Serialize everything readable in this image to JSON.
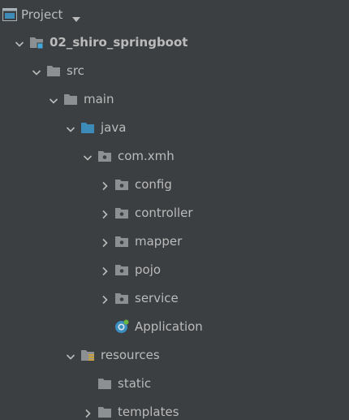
{
  "panel": {
    "title": "Project",
    "title_icon": "project-window-icon",
    "dropdown_icon": "dropdown-arrow-icon"
  },
  "tree": [
    {
      "label": "02_shiro_springboot",
      "icon": "module-folder-icon",
      "expanded": true,
      "has_chevron": true,
      "bold": true,
      "depth": 0
    },
    {
      "label": "src",
      "icon": "folder-icon",
      "expanded": true,
      "has_chevron": true,
      "bold": false,
      "depth": 1
    },
    {
      "label": "main",
      "icon": "folder-icon",
      "expanded": true,
      "has_chevron": true,
      "bold": false,
      "depth": 2
    },
    {
      "label": "java",
      "icon": "source-root-folder-icon",
      "expanded": true,
      "has_chevron": true,
      "bold": false,
      "depth": 3
    },
    {
      "label": "com.xmh",
      "icon": "package-icon",
      "expanded": true,
      "has_chevron": true,
      "bold": false,
      "depth": 4
    },
    {
      "label": "config",
      "icon": "package-icon",
      "expanded": false,
      "has_chevron": true,
      "bold": false,
      "depth": 5
    },
    {
      "label": "controller",
      "icon": "package-icon",
      "expanded": false,
      "has_chevron": true,
      "bold": false,
      "depth": 5
    },
    {
      "label": "mapper",
      "icon": "package-icon",
      "expanded": false,
      "has_chevron": true,
      "bold": false,
      "depth": 5
    },
    {
      "label": "pojo",
      "icon": "package-icon",
      "expanded": false,
      "has_chevron": true,
      "bold": false,
      "depth": 5
    },
    {
      "label": "service",
      "icon": "package-icon",
      "expanded": false,
      "has_chevron": true,
      "bold": false,
      "depth": 5
    },
    {
      "label": "Application",
      "icon": "spring-boot-class-icon",
      "expanded": false,
      "has_chevron": false,
      "bold": false,
      "depth": 5
    },
    {
      "label": "resources",
      "icon": "resources-root-folder-icon",
      "expanded": true,
      "has_chevron": true,
      "bold": false,
      "depth": 3
    },
    {
      "label": "static",
      "icon": "folder-icon",
      "expanded": false,
      "has_chevron": false,
      "bold": false,
      "depth": 4
    },
    {
      "label": "templates",
      "icon": "folder-icon",
      "expanded": false,
      "has_chevron": true,
      "bold": false,
      "depth": 4
    }
  ],
  "colors": {
    "background": "#3c3f41",
    "text": "#bbbbbb",
    "folder_gray": "#8c9093",
    "source_blue": "#3d8bb8",
    "module_blue": "#40a9d9",
    "resources_yellow": "#c9a13a",
    "spring_green": "#6db33f"
  }
}
